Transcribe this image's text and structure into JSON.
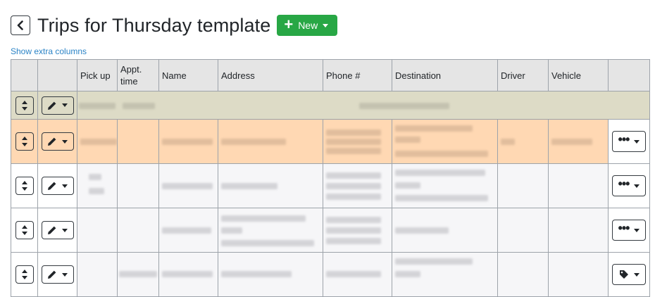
{
  "header": {
    "title": "Trips for Thursday template",
    "new_label": "New"
  },
  "extra_columns_link": "Show extra columns",
  "table": {
    "columns": [
      "",
      "",
      "Pick up",
      "Appt. time",
      "Name",
      "Address",
      "Phone #",
      "Destination",
      "Driver",
      "Vehicle",
      ""
    ]
  },
  "colors": {
    "group_row": "#dddbc6",
    "highlight_row": "#ffd8b3",
    "new_button": "#28a745",
    "link": "#2a83c6"
  },
  "icons": {
    "back": "chevron-left-icon",
    "drag": "sort-arrows-icon",
    "edit": "pencil-icon",
    "more": "ellipsis-icon",
    "tag": "tag-icon"
  }
}
